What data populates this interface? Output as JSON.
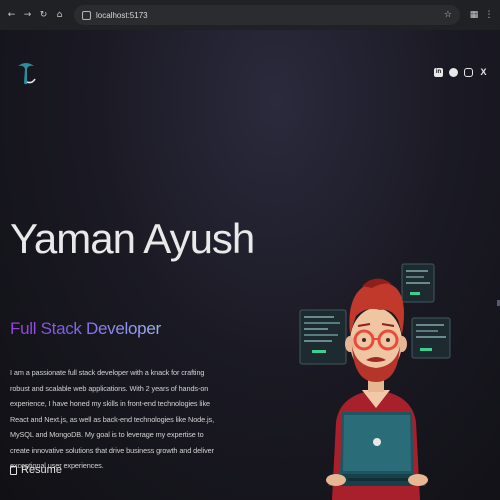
{
  "browser": {
    "url": "localhost:5173",
    "back_icon": "arrow-left-icon",
    "forward_icon": "arrow-right-icon",
    "reload_icon": "reload-icon",
    "home_icon": "home-icon",
    "bookmark_icon": "star-icon",
    "extension_icon": "puzzle-icon",
    "menu_icon": "kebab-menu-icon"
  },
  "header": {
    "logo_icon": "logo-icon",
    "socials": [
      {
        "name": "linkedin",
        "label": "in"
      },
      {
        "name": "github",
        "label": ""
      },
      {
        "name": "instagram",
        "label": ""
      },
      {
        "name": "x",
        "label": "X"
      }
    ]
  },
  "hero": {
    "name": "Yaman Ayush",
    "role": "Full Stack Developer",
    "bio": "I am a passionate full stack developer with a knack for crafting robust and scalable web applications. With 2 years of hands-on experience, I have honed my skills in front-end technologies like React and Next.js, as well as back-end technologies like Node.js, MySQL and MongoDB. My goal is to leverage my expertise to create innovative solutions that drive business growth and deliver exceptional user experiences.",
    "resume_label": "Resume"
  },
  "colors": {
    "role_gradient_start": "#9a3fdc",
    "role_gradient_end": "#9eb4f0",
    "laptop": "#1f5560",
    "hair": "#c0392b"
  }
}
